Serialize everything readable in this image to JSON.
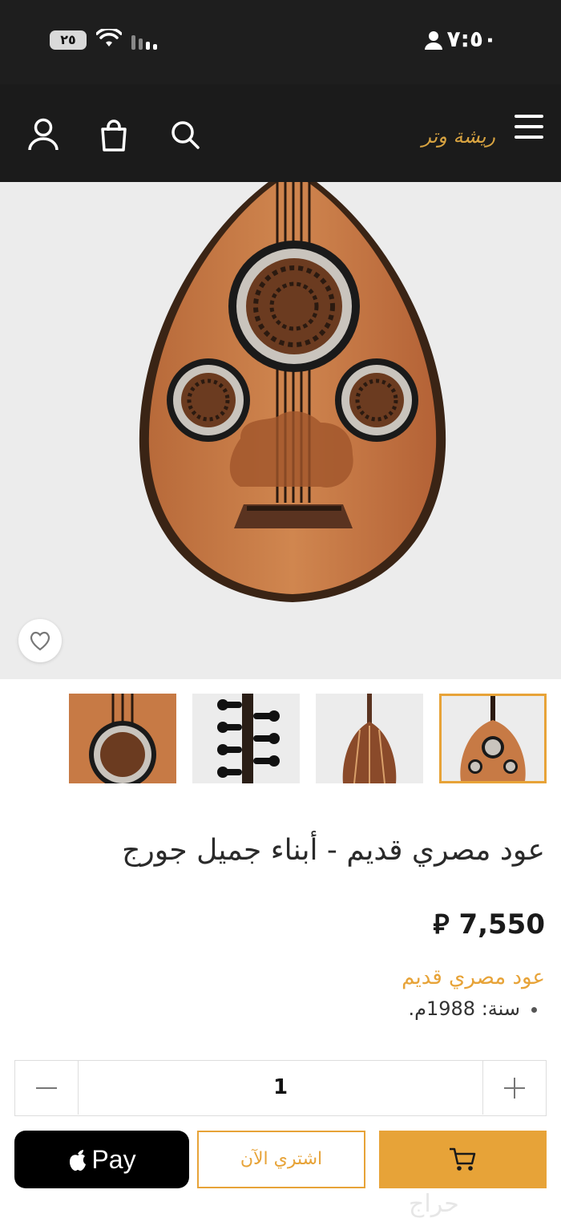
{
  "status_bar": {
    "time": "٧:٥٠",
    "battery": "٢٥"
  },
  "header": {
    "logo_text": "ريشة وتر",
    "cart_count": "0"
  },
  "product": {
    "title": "عود مصري قديم - أبناء جميل جورج",
    "price": "7,550 ⃁",
    "subtitle": "عود مصري قديم",
    "details": [
      "سنة: 1988م."
    ]
  },
  "gallery": {
    "thumbnail_count": 4,
    "active_index": 3
  },
  "quantity": {
    "value": "1"
  },
  "actions": {
    "apple_pay_label": "Pay",
    "buy_now_label": "اشتري الآن"
  },
  "colors": {
    "accent": "#e7a338",
    "header_bg": "#1b1b1b",
    "badge": "#f0564f"
  },
  "watermark": "حراج"
}
